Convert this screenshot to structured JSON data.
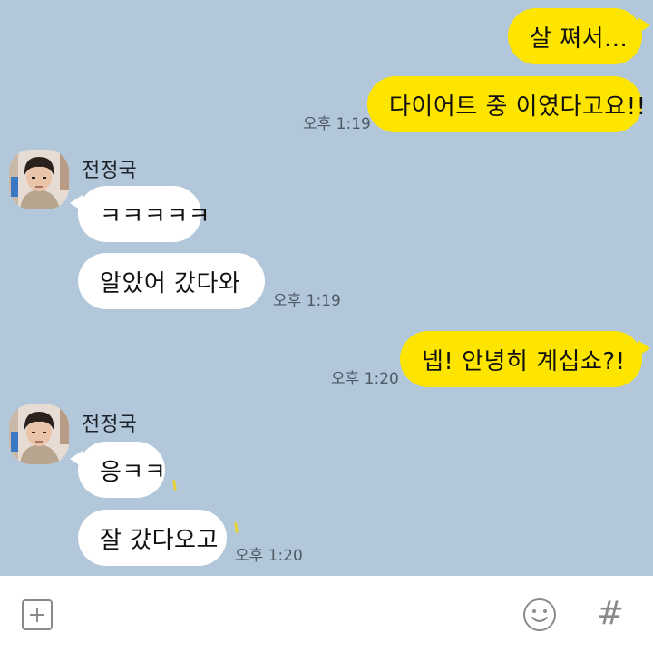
{
  "contact": {
    "name": "전정국"
  },
  "messages": [
    {
      "sender": "me",
      "text": "살 쪄서..."
    },
    {
      "sender": "me",
      "text": "다이어트 중 이였다고요!!",
      "time": "오후 1:19"
    },
    {
      "sender": "them",
      "text": "ㅋㅋㅋㅋㅋ"
    },
    {
      "sender": "them",
      "text": "알았어 갔다와",
      "time": "오후 1:19"
    },
    {
      "sender": "me",
      "text": "넵! 안녕히 계십쇼?!",
      "time": "오후 1:20"
    },
    {
      "sender": "them",
      "text": "응ㅋㅋ"
    },
    {
      "sender": "them",
      "text": "잘 갔다오고",
      "time": "오후 1:20"
    }
  ],
  "icons": {
    "add": "plus-icon",
    "emoji": "smiley-icon",
    "hashtag": "hashtag-icon"
  },
  "input_bar": {
    "hash_glyph": "#"
  },
  "colors": {
    "chat_background": "#b2c7d9",
    "my_bubble": "#fee500",
    "their_bubble": "#ffffff",
    "timestamp": "#4f5a66",
    "icon_gray": "#8a8a8a"
  }
}
